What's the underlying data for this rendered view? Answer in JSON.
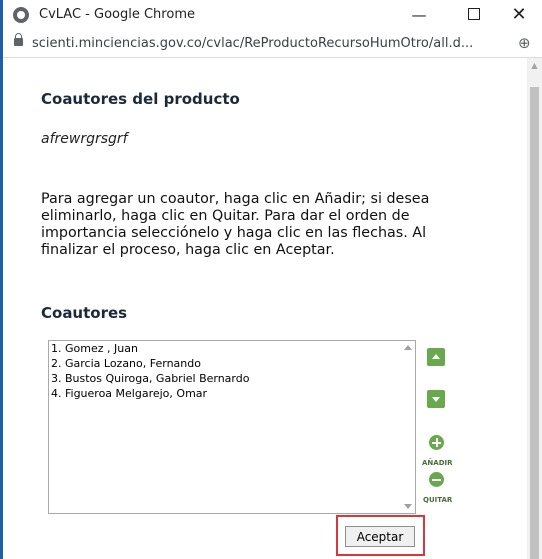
{
  "window": {
    "title": "CvLAC - Google Chrome",
    "url": "scienti.minciencias.gov.co/cvlac/ReProductoRecursoHumOtro/all.d..."
  },
  "content": {
    "heading": "Coautores del producto",
    "product_title": "afrewrgrsgrf",
    "instructions": "Para agregar un coautor, haga clic en Añadir; si desea eliminarlo, haga clic en Quitar. Para dar el orden de importancia selecciónelo y haga clic en las flechas. Al finalizar el proceso, haga clic en Aceptar.",
    "coauthors_heading": "Coautores",
    "coauthors": [
      "1. Gomez , Juan",
      "2. Garcia Lozano, Fernando",
      "3. Bustos Quiroga, Gabriel Bernardo",
      "4. Figueroa Melgarejo, Omar"
    ],
    "add_label": "AÑADIR",
    "remove_label": "QUITAR",
    "accept_label": "Aceptar"
  },
  "colors": {
    "accent_green": "#6aa84f",
    "highlight_red": "#d9363e",
    "window_border": "#1f5fa8"
  }
}
